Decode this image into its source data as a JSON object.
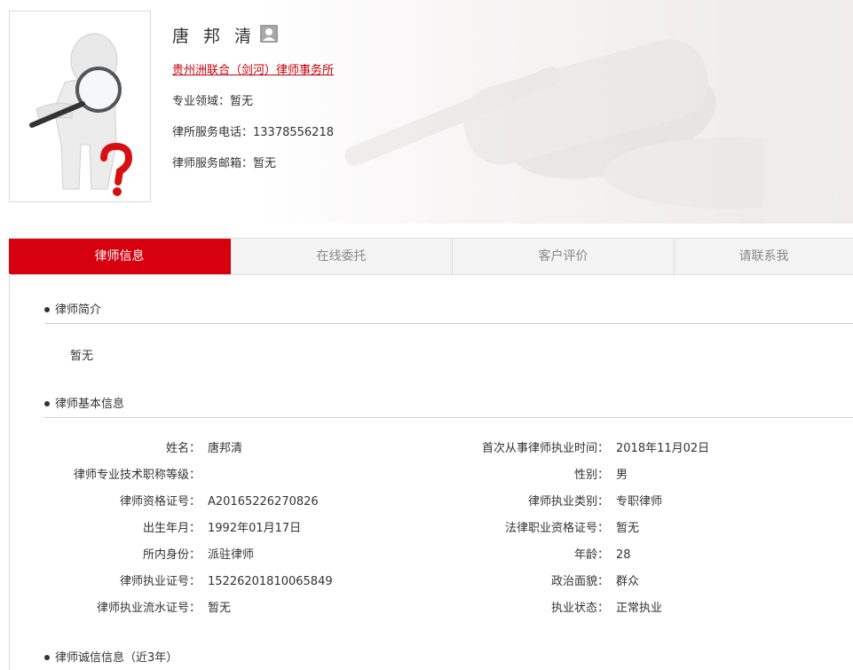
{
  "profile": {
    "name": "唐 邦 清",
    "firm": "贵州洲联合（剑河）律师事务所",
    "specialty_label": "专业领域：",
    "specialty_value": "暂无",
    "phone_label": "律所服务电话：",
    "phone_value": "13378556218",
    "email_label": "律师服务邮箱：",
    "email_value": "暂无"
  },
  "tabs": [
    {
      "label": "律师信息",
      "active": true
    },
    {
      "label": "在线委托",
      "active": false
    },
    {
      "label": "客户评价",
      "active": false
    },
    {
      "label": "请联系我",
      "active": false
    }
  ],
  "sections": {
    "intro": {
      "title": "律师简介",
      "text": "暂无"
    },
    "basic": {
      "title": "律师基本信息",
      "left": [
        {
          "label": "姓名：",
          "value": "唐邦清"
        },
        {
          "label": "律师专业技术职称等级：",
          "value": ""
        },
        {
          "label": "律师资格证号：",
          "value": "A20165226270826"
        },
        {
          "label": "出生年月：",
          "value": "1992年01月17日"
        },
        {
          "label": "所内身份：",
          "value": "派驻律师"
        },
        {
          "label": "律师执业证号：",
          "value": "15226201810065849"
        },
        {
          "label": "律师执业流水证号：",
          "value": "暂无"
        }
      ],
      "right": [
        {
          "label": "首次从事律师执业时间：",
          "value": "2018年11月02日"
        },
        {
          "label": "性别：",
          "value": "男"
        },
        {
          "label": "律师执业类别：",
          "value": "专职律师"
        },
        {
          "label": "法律职业资格证号：",
          "value": "暂无"
        },
        {
          "label": "年龄：",
          "value": "28"
        },
        {
          "label": "政治面貌：",
          "value": "群众"
        },
        {
          "label": "执业状态：",
          "value": "正常执业"
        }
      ]
    },
    "integrity": {
      "title": "律师诚信信息（近3年）"
    }
  },
  "colors": {
    "accent": "#d6000f",
    "link": "#c8000a",
    "tab_bg": "#f4f4f4"
  },
  "icons": {
    "avatar": "magnifier-question-figure",
    "person": "person-icon",
    "bullet": "bullet-dot-icon"
  }
}
